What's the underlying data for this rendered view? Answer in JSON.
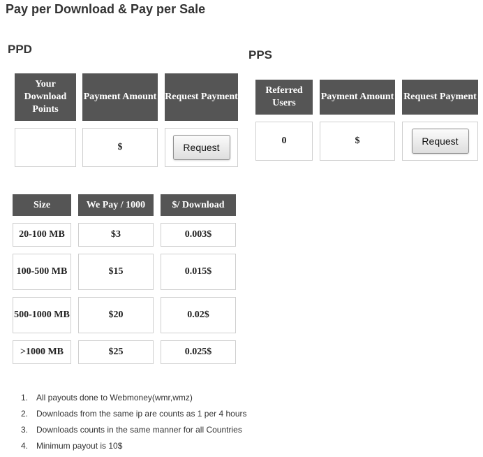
{
  "page": {
    "title": "Pay per Download & Pay per Sale"
  },
  "ppd": {
    "heading": "PPD",
    "headers": [
      "Your Download Points",
      "Payment Amount",
      "Request Payment"
    ],
    "values": {
      "points": "",
      "amount": "$",
      "button": "Request"
    }
  },
  "pps": {
    "heading": "PPS",
    "headers": [
      "Referred Users",
      "Payment Amount",
      "Request Payment"
    ],
    "values": {
      "users": "0",
      "amount": "$",
      "button": "Request"
    }
  },
  "rates": {
    "headers": [
      "Size",
      "We Pay / 1000",
      "$/ Download"
    ],
    "rows": [
      [
        "20-100 MB",
        "$3",
        "0.003$"
      ],
      [
        "100-500 MB",
        "$15",
        "0.015$"
      ],
      [
        "500-1000 MB",
        "$20",
        "0.02$"
      ],
      [
        ">1000 MB",
        "$25",
        "0.025$"
      ]
    ]
  },
  "notes": [
    "All payouts done to Webmoney(wmr,wmz)",
    "Downloads from the same ip are counts as 1 per 4 hours",
    "Downloads counts in the same manner for all Countries",
    "Minimum payout is 10$"
  ]
}
